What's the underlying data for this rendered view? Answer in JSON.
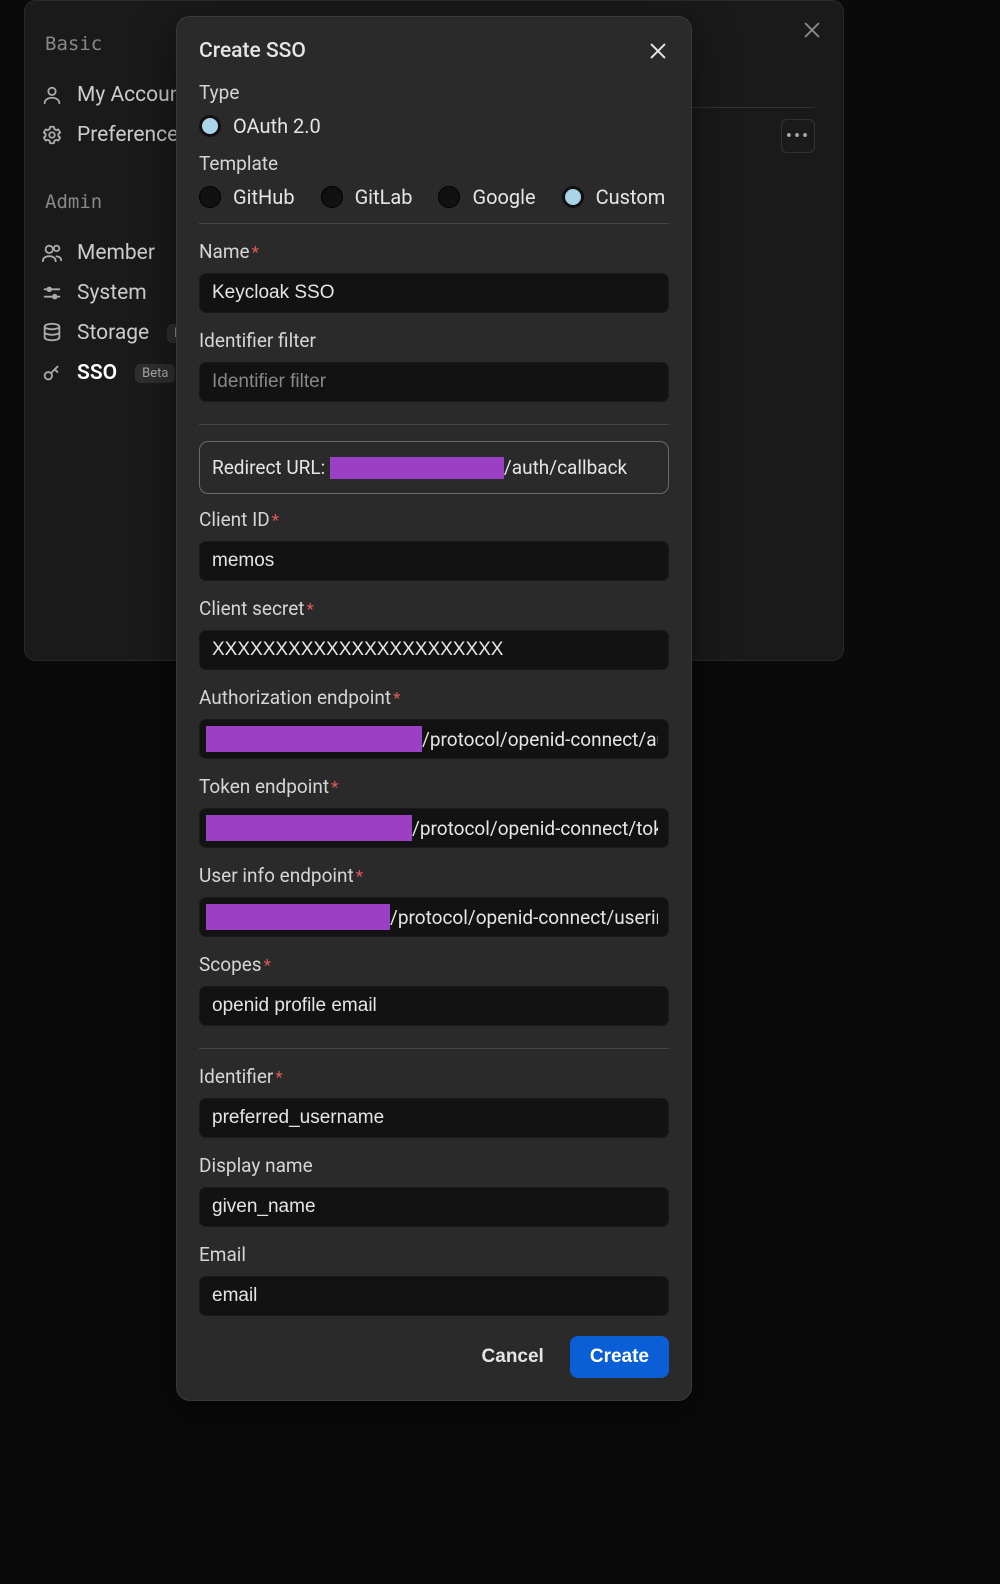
{
  "settings": {
    "sections": {
      "basic": "Basic",
      "admin": "Admin"
    },
    "items": {
      "my_account": "My Account",
      "preferences": "Preferences",
      "member": "Member",
      "system": "System",
      "storage": "Storage",
      "sso": "SSO"
    },
    "badge_beta": "Beta"
  },
  "modal": {
    "title": "Create SSO",
    "type_label": "Type",
    "type_options": {
      "oauth2": "OAuth 2.0"
    },
    "template_label": "Template",
    "template_options": {
      "github": "GitHub",
      "gitlab": "GitLab",
      "google": "Google",
      "custom": "Custom"
    },
    "name_label": "Name",
    "name_value": "Keycloak SSO",
    "identifier_filter_label": "Identifier filter",
    "identifier_filter_placeholder": "Identifier filter",
    "redirect_prefix": "Redirect URL:",
    "redirect_suffix": "/auth/callback",
    "client_id_label": "Client ID",
    "client_id_value": "memos",
    "client_secret_label": "Client secret",
    "client_secret_value": "XXXXXXXXXXXXXXXXXXXXXXX",
    "auth_endpoint_label": "Authorization endpoint",
    "auth_endpoint_suffix": "/protocol/openid-connect/auth",
    "token_endpoint_label": "Token endpoint",
    "token_endpoint_suffix": "/protocol/openid-connect/token",
    "userinfo_endpoint_label": "User info endpoint",
    "userinfo_endpoint_suffix": "/protocol/openid-connect/userinfo",
    "scopes_label": "Scopes",
    "scopes_value": "openid profile email",
    "identifier_label": "Identifier",
    "identifier_value": "preferred_username",
    "display_name_label": "Display name",
    "display_name_value": "given_name",
    "email_label": "Email",
    "email_value": "email",
    "cancel_label": "Cancel",
    "create_label": "Create"
  },
  "colors": {
    "redaction": "#9b3fc4",
    "primary": "#0b5fd6"
  }
}
